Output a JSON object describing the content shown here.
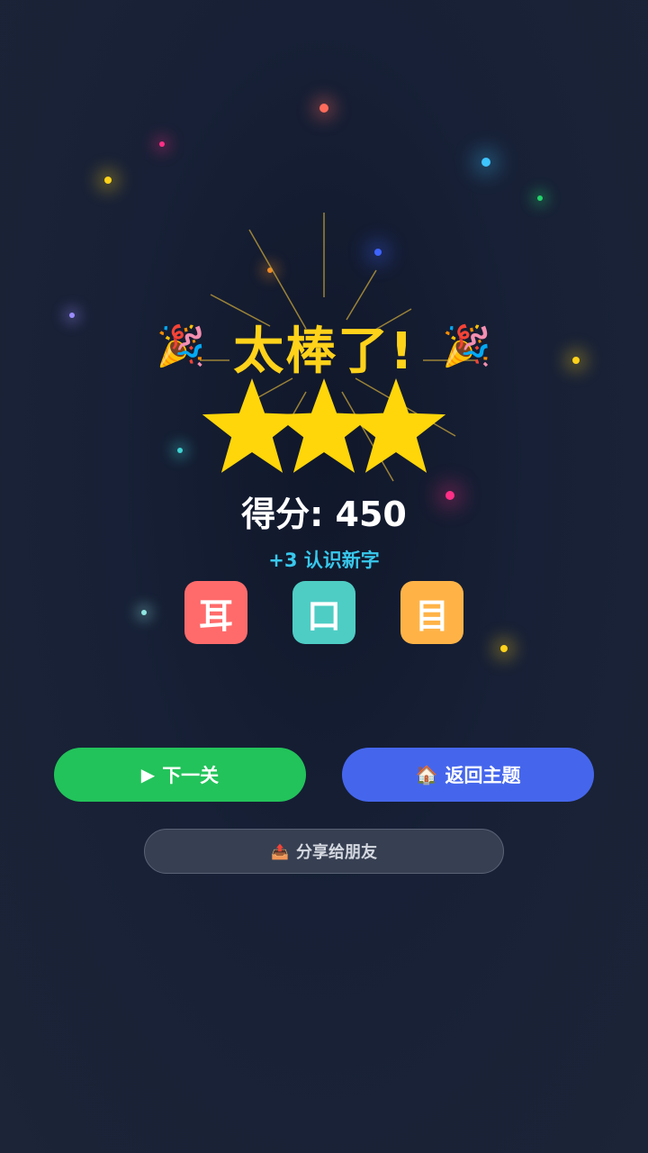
{
  "result": {
    "title": "太棒了!",
    "party_icon": "party-popper-icon",
    "party_glyph": "🎉",
    "stars_earned": 3,
    "stars_total": 3,
    "star_color": "#ffd60a",
    "score_text": "得分: 450",
    "learned_text": "+3 认识新字"
  },
  "learned_chars": [
    {
      "char": "耳",
      "color": "#ff6b6b"
    },
    {
      "char": "口",
      "color": "#4ecdc4"
    },
    {
      "char": "目",
      "color": "#ffb347"
    }
  ],
  "buttons": {
    "next": {
      "label": "下一关",
      "icon": "play-icon",
      "glyph": "▶",
      "color": "#22c35a"
    },
    "back": {
      "label": "返回主题",
      "icon": "home-icon",
      "glyph": "🏠",
      "color": "#4566ec"
    },
    "share": {
      "label": "分享给朋友",
      "icon": "share-inbox-icon",
      "glyph": "📤"
    }
  }
}
